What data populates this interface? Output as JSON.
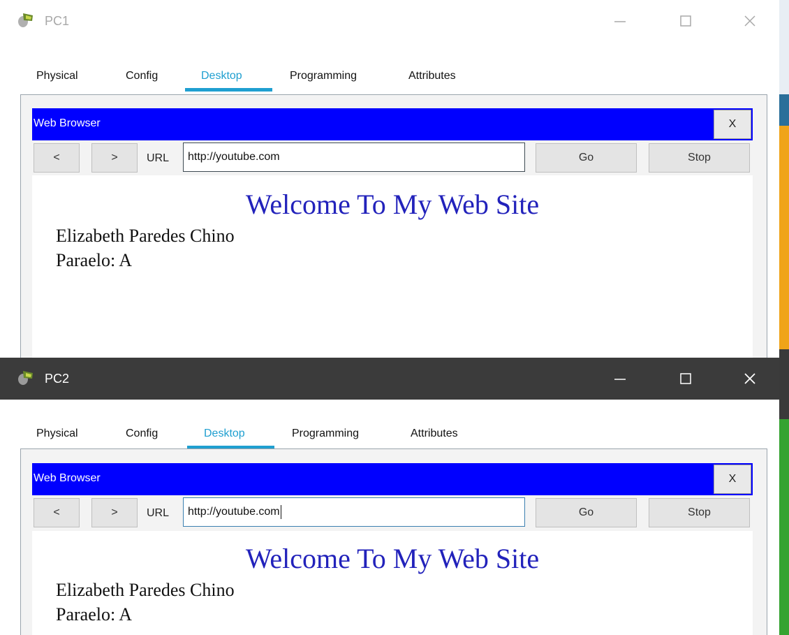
{
  "windows": [
    {
      "id": "pc1",
      "title": "PC1",
      "tabs": [
        "Physical",
        "Config",
        "Desktop",
        "Programming",
        "Attributes"
      ],
      "active_tab": "Desktop",
      "browser": {
        "title": "Web Browser",
        "close_label": "X",
        "back_label": "<",
        "forward_label": ">",
        "url_label": "URL",
        "url_value": "http://youtube.com",
        "go_label": "Go",
        "stop_label": "Stop",
        "page": {
          "heading": "Welcome To My Web Site",
          "line1": "Elizabeth Paredes Chino",
          "line2": "Paraelo: A"
        }
      }
    },
    {
      "id": "pc2",
      "title": "PC2",
      "tabs": [
        "Physical",
        "Config",
        "Desktop",
        "Programming",
        "Attributes"
      ],
      "active_tab": "Desktop",
      "browser": {
        "title": "Web Browser",
        "close_label": "X",
        "back_label": "<",
        "forward_label": ">",
        "url_label": "URL",
        "url_value": "http://youtube.com",
        "go_label": "Go",
        "stop_label": "Stop",
        "page": {
          "heading": "Welcome To My Web Site",
          "line1": "Elizabeth Paredes Chino",
          "line2": "Paraelo: A"
        }
      }
    }
  ],
  "colors": {
    "browser_header": "#0000ff",
    "active_tab": "#1f9fd0",
    "page_heading": "#2222bb",
    "pc2_titlebar": "#3b3b3b"
  }
}
